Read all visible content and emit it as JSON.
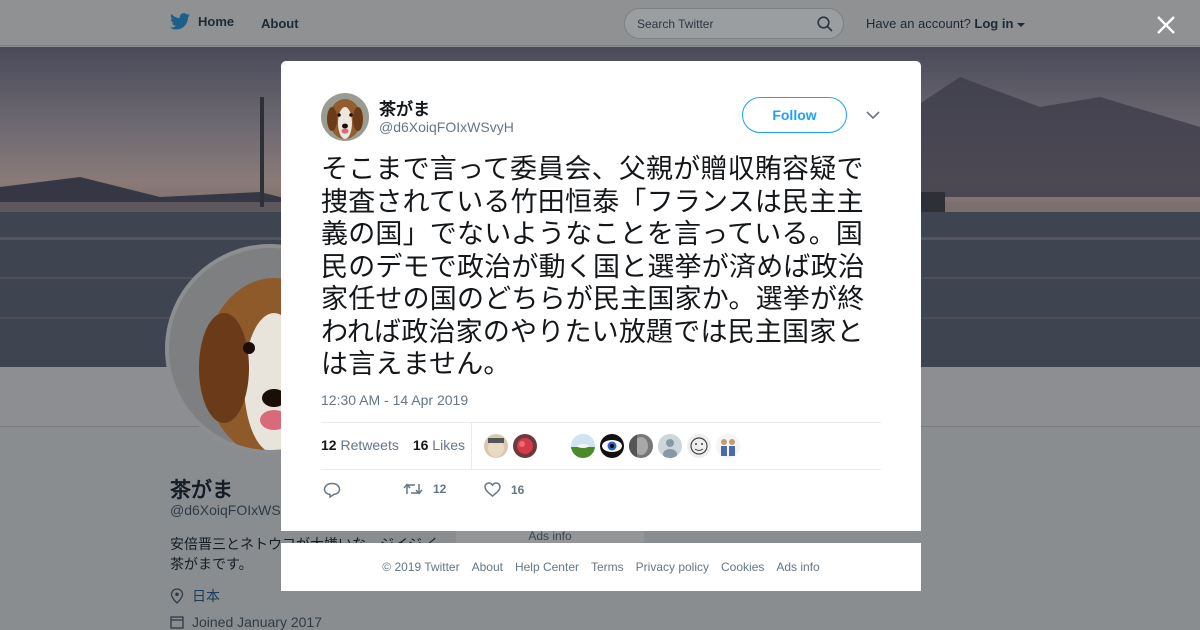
{
  "topbar": {
    "home_label": "Home",
    "about_label": "About",
    "search_placeholder": "Search Twitter",
    "have_account_text": "Have an account?",
    "login_label": "Log in"
  },
  "profile": {
    "name": "茶がま",
    "handle": "@d6XoiqFOIxWSvyH",
    "bio": "安倍晋三とネトウヨが大嫌いな、ジイジ く茶がまです。",
    "location": "日本",
    "joined": "Joined January 2017",
    "ads_info": "Ads info"
  },
  "tweet": {
    "author_name": "茶がま",
    "author_handle": "@d6XoiqFOIxWSvyH",
    "follow_label": "Follow",
    "text": "そこまで言って委員会、父親が贈収賄容疑で捜査されている竹田恒泰「フランスは民主主義の国」でないようなことを言っている。国民のデモで政治が動く国と選挙が済めば政治家任せの国のどちらが民主国家か。選挙が終われば政治家のやりたい放題では民主国家とは言えません。",
    "timestamp": "12:30 AM - 14 Apr 2019",
    "retweets_count": "12",
    "retweets_label": "Retweets",
    "likes_count": "16",
    "likes_label": "Likes",
    "action_retweet_count": "12",
    "action_like_count": "16"
  },
  "footer": {
    "links": [
      "© 2019 Twitter",
      "About",
      "Help Center",
      "Terms",
      "Privacy policy",
      "Cookies",
      "Ads info"
    ]
  },
  "colors": {
    "accent": "#1da1f2",
    "text": "#14171a",
    "muted": "#657786",
    "overlay": "#8a8d90"
  }
}
